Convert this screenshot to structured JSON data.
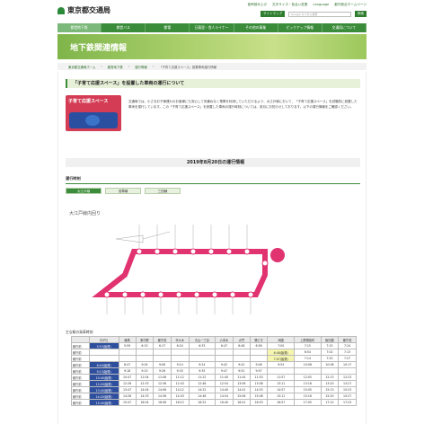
{
  "header": {
    "logo_text": "東京都交通局",
    "util_links": [
      "音声読み上げ",
      "文字サイズ・色合い変更",
      "Language",
      "都庁総合ホームページ"
    ],
    "sitemap_label": "サイトマップ",
    "search_placeholder": "Google カスタム検索",
    "search_button": "検索"
  },
  "nav": [
    {
      "label": "都営地下鉄",
      "active": true
    },
    {
      "label": "都営バス",
      "active": false
    },
    {
      "label": "都電",
      "active": false
    },
    {
      "label": "日暮里・舎人ライナー",
      "active": false
    },
    {
      "label": "その他の事業",
      "active": false
    },
    {
      "label": "ピックアップ情報",
      "active": false
    },
    {
      "label": "交通局について",
      "active": false
    }
  ],
  "banner": {
    "title": "地下鉄関連情報"
  },
  "breadcrumb": [
    "東京都交通局ホーム",
    "都営地下鉄",
    "運行情報",
    "「子育て応援スペース」設置車両運行情報"
  ],
  "section1": {
    "title": "「子育て応援スペース」を設置した車両の運行について",
    "image_text": "子育て応援スペース",
    "body": "交通局では、小さなお子様連れのお客様にも安心して気兼ねなく電車を利用していただけるよう、大江戸線において、「子育て応援スペース」を試験的に設置した車両を運行しています。この「子育て応援スペース」を設置した車両の運行時刻については、前月にお知らせしております。以下の運行情報をご確認ください。"
  },
  "section2": {
    "title": "2019年8月20日の運行情報"
  },
  "section3": {
    "title": "運行時刻"
  },
  "tabs": [
    {
      "label": "大江戸線",
      "active": true
    },
    {
      "label": "浅草線",
      "active": false
    },
    {
      "label": "三田線",
      "active": false
    }
  ],
  "line_name": "大江戸線内回り",
  "table_caption": "主な駅の発車時刻",
  "table": {
    "headers": [
      "",
      "光が丘",
      "練馬",
      "東中野",
      "都庁前",
      "代々木",
      "青山一丁目",
      "六本木",
      "大門",
      "勝どき",
      "両国",
      "上野御徒町",
      "飯田橋",
      "都庁前"
    ],
    "rows": [
      [
        "都庁前",
        "5:53(始発)",
        "5:59",
        "6:15",
        "6:17",
        "6:24",
        "6:33",
        "6:47",
        "6:48",
        "6:56",
        "7:00",
        "7:15",
        "7:15",
        "7:24"
      ],
      [
        "都庁前",
        "",
        "",
        "",
        "",
        "",
        "",
        "",
        "",
        "",
        "6:48(始発)",
        "6:54",
        "7:02",
        "7:13"
      ],
      [
        "都庁前",
        "",
        "",
        "",
        "",
        "",
        "",
        "",
        "",
        "",
        "7:07(始発)",
        "7:14",
        "7:20",
        "7:27"
      ],
      [
        "都庁前",
        "8:40(始発)",
        "8:47",
        "9:04",
        "9:06",
        "9:14",
        "9:24",
        "9:42",
        "9:42",
        "9:48",
        "9:54",
        "10:08",
        "10:08",
        "10:17"
      ],
      [
        "都庁前",
        "9:13(始発)",
        "9:18",
        "9:23",
        "9:26",
        "9:33",
        "9:35",
        "9:47",
        "9:52",
        "9:57",
        "",
        "",
        "",
        ""
      ],
      [
        "都庁前",
        "10:40(始発)",
        "10:47",
        "11:04",
        "11:06",
        "11:12",
        "11:22",
        "11:40",
        "11:44",
        "11:53",
        "11:57",
        "12:05",
        "12:13",
        "12:23"
      ],
      [
        "都庁前",
        "12:20(始発)",
        "12:26",
        "12:33",
        "12:36",
        "12:43",
        "12:48",
        "12:54",
        "13:06",
        "13:08",
        "13:11",
        "13:16",
        "13:20",
        "13:27"
      ],
      [
        "都庁前",
        "13:40(始発)",
        "13:47",
        "14:04",
        "14:06",
        "14:12",
        "14:22",
        "14:40",
        "14:41",
        "14:53",
        "14:57",
        "15:05",
        "15:13",
        "15:23"
      ],
      [
        "都庁前",
        "14:20(始発)",
        "14:26",
        "14:33",
        "14:36",
        "14:43",
        "14:48",
        "14:54",
        "15:06",
        "15:08",
        "15:11",
        "15:16",
        "15:20",
        "15:27"
      ],
      [
        "都庁前",
        "15:40(始発)",
        "15:47",
        "16:04",
        "16:06",
        "16:12",
        "16:22",
        "16:40",
        "16:41",
        "16:53",
        "16:57",
        "17:05",
        "17:12",
        "17:23"
      ]
    ]
  },
  "colors": {
    "primary": "#3a8c3a",
    "line": "#e0336f",
    "banner": "#9cc85c"
  }
}
